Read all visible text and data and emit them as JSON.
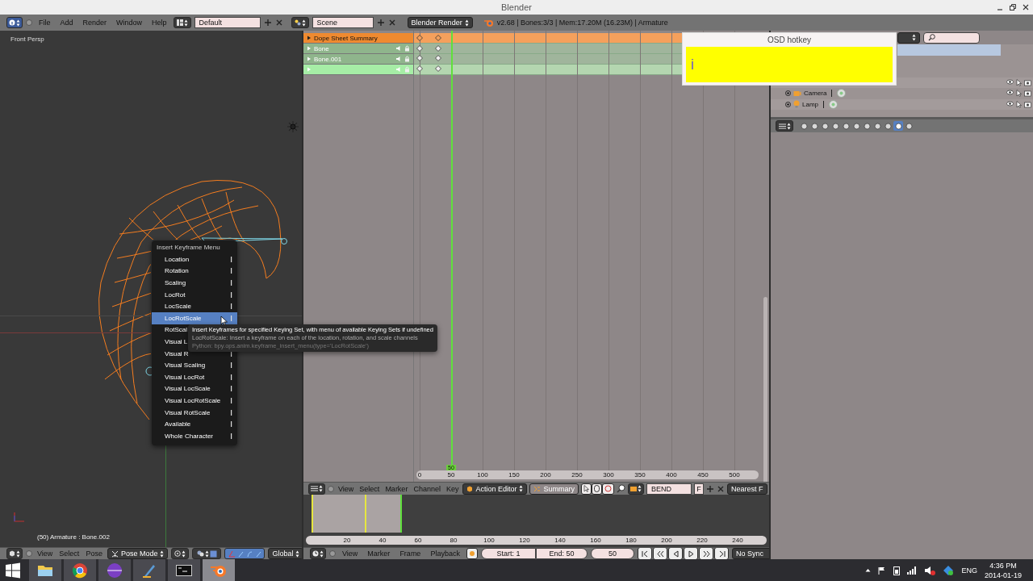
{
  "window": {
    "title": "Blender"
  },
  "info_header": {
    "menus": [
      "File",
      "Add",
      "Render",
      "Window",
      "Help"
    ],
    "screen_layout": "Default",
    "scene": "Scene",
    "render_engine": "Blender Render",
    "stats": "v2.68 | Bones:3/3 | Mem:17.20M (16.23M) | Armature"
  },
  "viewport": {
    "view_name": "Front Persp",
    "status": "(50) Armature : Bone.002",
    "header": {
      "menus": [
        "View",
        "Select",
        "Pose"
      ],
      "mode": "Pose Mode",
      "orientation": "Global"
    }
  },
  "insert_keyframe_menu": {
    "title": "Insert Keyframe Menu",
    "items": [
      {
        "label": "Location",
        "selected": false
      },
      {
        "label": "Rotation",
        "selected": false
      },
      {
        "label": "Scaling",
        "selected": false
      },
      {
        "label": "LocRot",
        "selected": false
      },
      {
        "label": "LocScale",
        "selected": false
      },
      {
        "label": "LocRotScale",
        "selected": true
      },
      {
        "label": "RotScal",
        "selected": false
      },
      {
        "label": "Visual L",
        "selected": false
      },
      {
        "label": "Visual R",
        "selected": false
      },
      {
        "label": "Visual Scaling",
        "selected": false
      },
      {
        "label": "Visual LocRot",
        "selected": false
      },
      {
        "label": "Visual LocScale",
        "selected": false
      },
      {
        "label": "Visual LocRotScale",
        "selected": false
      },
      {
        "label": "Visual RotScale",
        "selected": false
      },
      {
        "label": "Available",
        "selected": false
      },
      {
        "label": "Whole Character",
        "selected": false
      }
    ]
  },
  "tooltip": {
    "lines": [
      "Insert Keyframes for specified Keying Set, with menu of available Keying Sets if undefined",
      "LocRotScale: Insert a keyframe on each of the location, rotation, and scale channels",
      "Python: bpy.ops.anim.keyframe_insert_menu(type='LocRotScale')"
    ]
  },
  "dope_sheet": {
    "channels": [
      {
        "name": "Dope Sheet Summary",
        "kind": "summary",
        "selected": false
      },
      {
        "name": "Bone",
        "kind": "group",
        "selected": false
      },
      {
        "name": "Bone.001",
        "kind": "group",
        "selected": false
      },
      {
        "kind": "group",
        "selected": true
      }
    ],
    "current_frame": "50",
    "ruler": [
      "0",
      "50",
      "100",
      "150",
      "200",
      "250",
      "300",
      "350",
      "400",
      "450",
      "500"
    ],
    "header": {
      "menus": [
        "View",
        "Select",
        "Marker",
        "Channel",
        "Key"
      ],
      "mode": "Action Editor",
      "summary": "Summary",
      "action": "BEND",
      "fake_user": "F",
      "snap": "Nearest F"
    }
  },
  "timeline": {
    "ruler": [
      "20",
      "40",
      "60",
      "80",
      "100",
      "120",
      "140",
      "160",
      "180",
      "200",
      "220",
      "240"
    ],
    "header": {
      "menus": [
        "View",
        "Marker",
        "Frame",
        "Playback"
      ],
      "start": "Start: 1",
      "end": "End: 50",
      "frame": "50",
      "sync": "No Sync"
    }
  },
  "osd": {
    "title": "OSD hotkey",
    "key": "i"
  },
  "outliner": {
    "rows": [
      {
        "name": "Camera",
        "kind": "camera"
      },
      {
        "name": "Lamp",
        "kind": "lamp"
      }
    ]
  },
  "properties": {
    "tabs": [
      {
        "selected": false
      },
      {
        "selected": false
      },
      {
        "selected": false
      },
      {
        "selected": false
      },
      {
        "selected": false
      },
      {
        "selected": false
      },
      {
        "selected": false
      },
      {
        "selected": false
      },
      {
        "selected": false
      },
      {
        "selected": true
      },
      {
        "selected": false
      }
    ]
  },
  "taskbar": {
    "apps": [
      {
        "kind": "folder",
        "selected": false
      },
      {
        "kind": "browser",
        "selected": false
      },
      {
        "kind": "sphere",
        "selected": false
      },
      {
        "kind": "pen",
        "selected": false
      },
      {
        "kind": "terminal",
        "selected": false
      },
      {
        "kind": "blender",
        "selected": true
      }
    ],
    "language": "ENG",
    "time": "4:36 PM",
    "date": "2014-01-19"
  }
}
